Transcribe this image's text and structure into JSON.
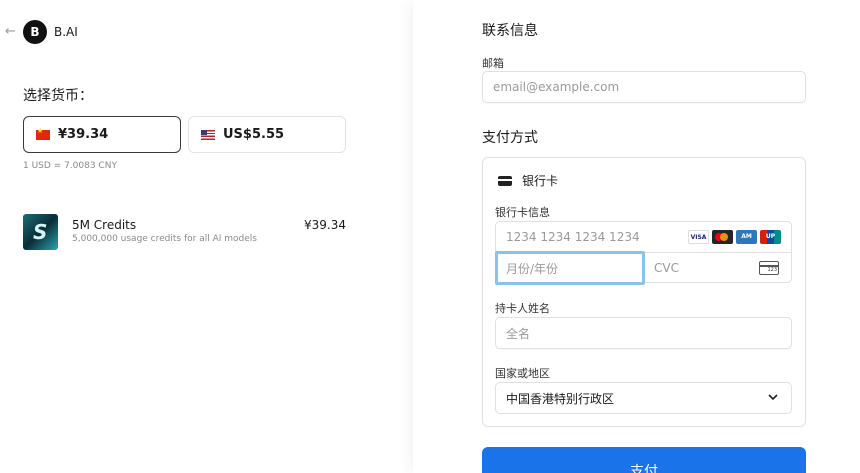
{
  "header": {
    "back_glyph": "←",
    "logo_glyph": "B",
    "brand": "B.AI"
  },
  "currency": {
    "label": "选择货币：",
    "options": [
      {
        "flag": "cn-flag",
        "label": "¥39.34",
        "selected": true
      },
      {
        "flag": "us-flag",
        "label": "US$5.55",
        "selected": false
      }
    ],
    "rate": "1 USD = 7.0083 CNY"
  },
  "product": {
    "name": "5M Credits",
    "description": "5,000,000 usage credits for all AI models",
    "price": "¥39.34"
  },
  "contact": {
    "title": "联系信息",
    "email_label": "邮箱",
    "email_placeholder": "email@example.com"
  },
  "payment": {
    "title": "支付方式",
    "method": "银行卡",
    "card_info_label": "银行卡信息",
    "card_number_placeholder": "1234 1234 1234 1234",
    "brands": [
      "VISA",
      "",
      "AM",
      "UP"
    ],
    "expiry_placeholder": "月份/年份",
    "cvc_placeholder": "CVC",
    "cvc_icon_text": "123",
    "name_label": "持卡人姓名",
    "name_placeholder": "全名",
    "country_label": "国家或地区",
    "country_value": "中国香港特别行政区",
    "pay_button": "支付"
  },
  "colors": {
    "accent": "#1a73e8",
    "focus": "#8cc2e8"
  }
}
